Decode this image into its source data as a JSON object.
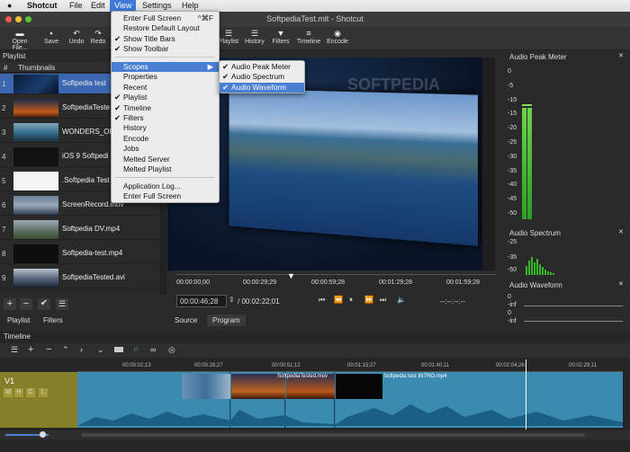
{
  "menubar": {
    "app": "Shotcut",
    "items": [
      "File",
      "Edit",
      "View",
      "Settings",
      "Help"
    ]
  },
  "window": {
    "title": "SoftpediaTest.mlt - Shotcut"
  },
  "toolbar": {
    "open": "Open File...",
    "save": "Save",
    "undo": "Undo",
    "redo": "Redo",
    "playlist": "Playlist",
    "history": "History",
    "filters": "Filters",
    "timeline": "Timeline",
    "encode": "Encode"
  },
  "playlist": {
    "title": "Playlist",
    "col_num": "#",
    "col_thumbs": "Thumbnails",
    "items": [
      {
        "num": "1",
        "name": "Softpedia test"
      },
      {
        "num": "2",
        "name": "SoftpediaTeste"
      },
      {
        "num": "3",
        "name": "WONDERS_OF"
      },
      {
        "num": "4",
        "name": "iOS 9 Softpedi"
      },
      {
        "num": "5",
        "name": ".Softpedia Test"
      },
      {
        "num": "6",
        "name": "ScreenRecord.mov"
      },
      {
        "num": "7",
        "name": "Softpedia DV.mp4"
      },
      {
        "num": "8",
        "name": "Softpedia-test.mp4"
      },
      {
        "num": "9",
        "name": "SoftpediaTested.avi"
      }
    ],
    "tab_playlist": "Playlist",
    "tab_filters": "Filters"
  },
  "view_menu": {
    "enter_full_screen": "Enter Full Screen",
    "enter_full_screen_shortcut": "^⌘F",
    "restore_default_layout": "Restore Default Layout",
    "show_title_bars": "Show Title Bars",
    "show_toolbar": "Show Toolbar",
    "scopes": "Scopes",
    "properties": "Properties",
    "recent": "Recent",
    "playlist": "Playlist",
    "timeline": "Timeline",
    "filters": "Filters",
    "history": "History",
    "encode": "Encode",
    "jobs": "Jobs",
    "melted_server": "Melted Server",
    "melted_playlist": "Melted Playlist",
    "application_log": "Application Log...",
    "enter_full_screen_2": "Enter Full Screen"
  },
  "scopes_menu": {
    "audio_peak_meter": "Audio Peak Meter",
    "audio_spectrum": "Audio Spectrum",
    "audio_waveform": "Audio Waveform"
  },
  "viewer": {
    "ruler": [
      "00:00:00;00",
      "00:00:29;29",
      "00:00:59;28",
      "00:01:29;28",
      "00:01:59;28"
    ],
    "current_time": "00:00:46;28",
    "total_time": "/ 00:02:22;01",
    "in_out": "--:--:--:--",
    "tab_source": "Source",
    "tab_program": "Program",
    "watermark": "SOFTPEDIA"
  },
  "meters": {
    "peak_title": "Audio Peak Meter",
    "peak_scale": [
      "0",
      "-5",
      "-10",
      "-15",
      "-20",
      "-25",
      "-30",
      "-35",
      "-40",
      "-45",
      "-50"
    ],
    "spectrum_title": "Audio Spectrum",
    "spectrum_scale": [
      "-25",
      "-35",
      "-50"
    ],
    "waveform_title": "Audio Waveform",
    "waveform_scale": [
      "0",
      "-inf",
      "0",
      "-inf"
    ]
  },
  "timeline": {
    "title": "Timeline",
    "track_name": "V1",
    "track_buttons": [
      "M",
      "H",
      "C",
      "L"
    ],
    "ruler": [
      "00:00:02;13",
      "00:00:26;27",
      "00:00:51;12",
      "00:01:15;27",
      "00:01:40;11",
      "00:02:04;26",
      "00:02:29;11"
    ],
    "clip_labels": [
      "SoftpediaTested.mov",
      "Softpedia test INTRO.mp4"
    ]
  }
}
